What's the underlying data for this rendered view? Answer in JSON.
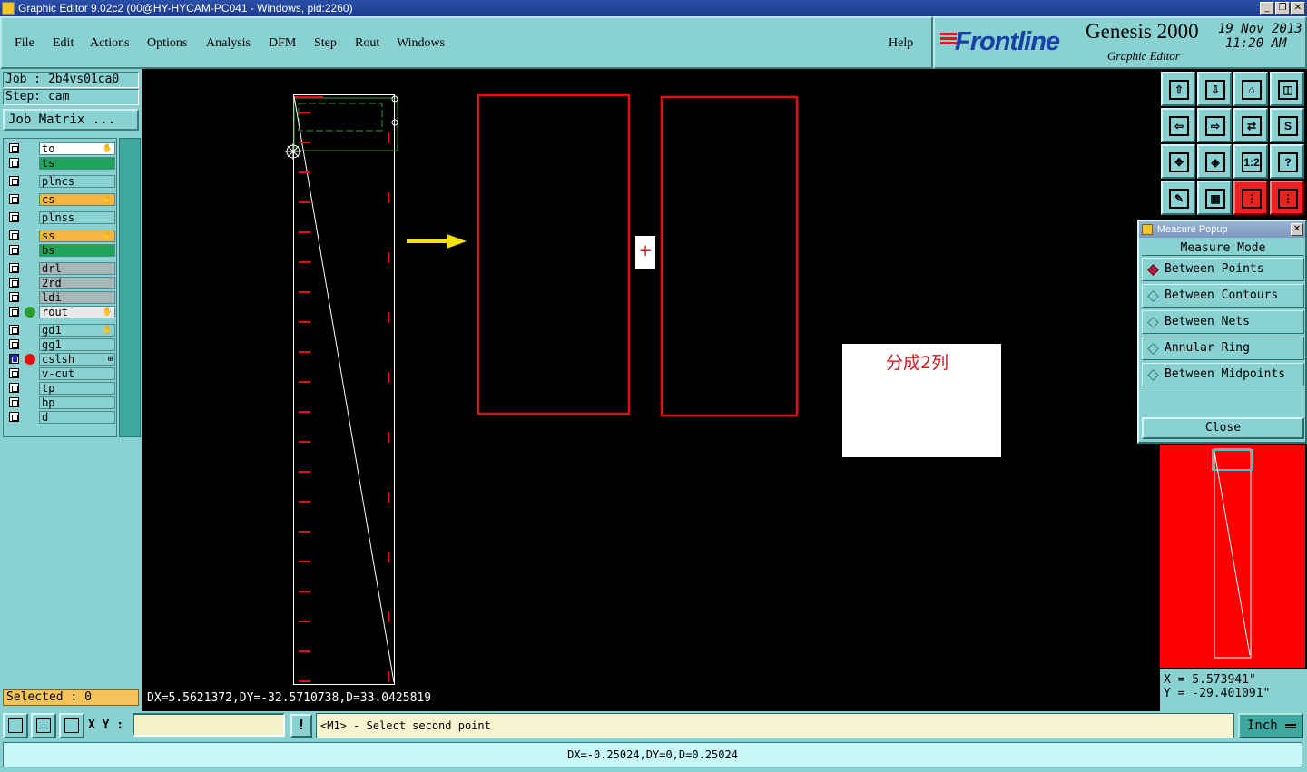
{
  "window": {
    "title": "Graphic Editor 9.02c2 (00@HY-HYCAM-PC041 - Windows, pid:2260)",
    "min_glyph": "_",
    "max_glyph": "❐",
    "close_glyph": "✕"
  },
  "menu": {
    "items": [
      {
        "label": "File"
      },
      {
        "label": "Edit"
      },
      {
        "label": "Actions"
      },
      {
        "label": "Options"
      },
      {
        "label": "Analysis"
      },
      {
        "label": "DFM"
      },
      {
        "label": "Step"
      },
      {
        "label": "Rout"
      },
      {
        "label": "Windows"
      }
    ],
    "help": "Help"
  },
  "logo": {
    "brand": "Frontline",
    "product": "Genesis 2000",
    "subtitle": "Graphic Editor",
    "date": "19 Nov 2013",
    "time": "11:20 AM"
  },
  "job": {
    "job_label": "Job : 2b4vs01ca0",
    "step_label": "Step: cam",
    "matrix_button": "Job Matrix ..."
  },
  "layers": [
    {
      "name": "to",
      "bg": "#ffffff",
      "mark": "✋"
    },
    {
      "name": "ts",
      "bg": "#1fa35c",
      "mark": ""
    },
    {
      "name": "plncs",
      "bg": "#8ad1d1",
      "mark": ""
    },
    {
      "name": "cs",
      "bg": "#f4b640",
      "mark": "✋"
    },
    {
      "name": "plnss",
      "bg": "#8ad1d1",
      "mark": ""
    },
    {
      "name": "ss",
      "bg": "#f4b640",
      "mark": "✋"
    },
    {
      "name": "bs",
      "bg": "#1fa35c",
      "mark": ""
    },
    {
      "name": "drl",
      "bg": "#a8b8b8",
      "mark": ""
    },
    {
      "name": "2rd",
      "bg": "#a8b8b8",
      "mark": ""
    },
    {
      "name": "ldi",
      "bg": "#a8b8b8",
      "mark": ""
    },
    {
      "name": "rout",
      "bg": "#e8e8e8",
      "mark": "✋",
      "dot": "#2a9a2a"
    },
    {
      "name": "gd1",
      "bg": "#8ad1d1",
      "mark": "✋"
    },
    {
      "name": "gg1",
      "bg": "#8ad1d1",
      "mark": ""
    },
    {
      "name": "cslsh",
      "bg": "#8ad1d1",
      "mark": "⊞",
      "dot": "#e21010",
      "selected": true
    },
    {
      "name": "v-cut",
      "bg": "#8ad1d1",
      "mark": ""
    },
    {
      "name": "tp",
      "bg": "#8ad1d1",
      "mark": ""
    },
    {
      "name": "bp",
      "bg": "#8ad1d1",
      "mark": ""
    },
    {
      "name": "d",
      "bg": "#8ad1d1",
      "mark": ""
    }
  ],
  "selected_label": "Selected : 0",
  "canvas": {
    "dx_readout": "DX=5.5621372,DY=-32.5710738,D=33.0425819",
    "note_text": "分成2列",
    "plus_glyph": "+"
  },
  "measure_popup": {
    "title": "Measure Popup",
    "close_glyph": "✕",
    "mode_label": "Measure Mode",
    "options": [
      {
        "label": "Between Points",
        "selected": true
      },
      {
        "label": "Between Contours",
        "selected": false
      },
      {
        "label": "Between Nets",
        "selected": false
      },
      {
        "label": "Annular Ring",
        "selected": false
      },
      {
        "label": "Between Midpoints",
        "selected": false
      }
    ],
    "close_button": "Close"
  },
  "coordinates": {
    "x": "X  =  5.573941\"",
    "y": "Y  = -29.401091\""
  },
  "toolbar_icons": [
    "zoom-home-icon",
    "zoom-fit-icon",
    "zoom-profile-icon",
    "split-view-icon",
    "pan-left-icon",
    "pan-right-icon",
    "swap-icon",
    "snap-icon",
    "zoom-extents-icon",
    "center-icon",
    "scale-1to2-icon",
    "help-icon",
    "tools-icon",
    "grid-icon",
    "netlist-icon",
    "netlist-alt-icon"
  ],
  "toolbar_glyphs": [
    "⇧",
    "⇩",
    "⌂",
    "◫",
    "⇦",
    "⇨",
    "⇄",
    "S",
    "✥",
    "◈",
    "1:2",
    "?",
    "✎",
    "▦",
    "⋮",
    "⋮"
  ],
  "bottom": {
    "xy_label": "X Y :",
    "xy_value": "",
    "excl_glyph": "!",
    "prompt": "<M1> - Select second point",
    "unit_label": "Inch"
  },
  "status": "DX=-0.25024,DY=0,D=0.25024",
  "colors": {
    "panel": "#8ad1d1",
    "canvas_bg": "#000000",
    "rout_red": "#e21010",
    "arrow_yellow": "#f4e010",
    "miniview_bg": "#ff0000"
  }
}
